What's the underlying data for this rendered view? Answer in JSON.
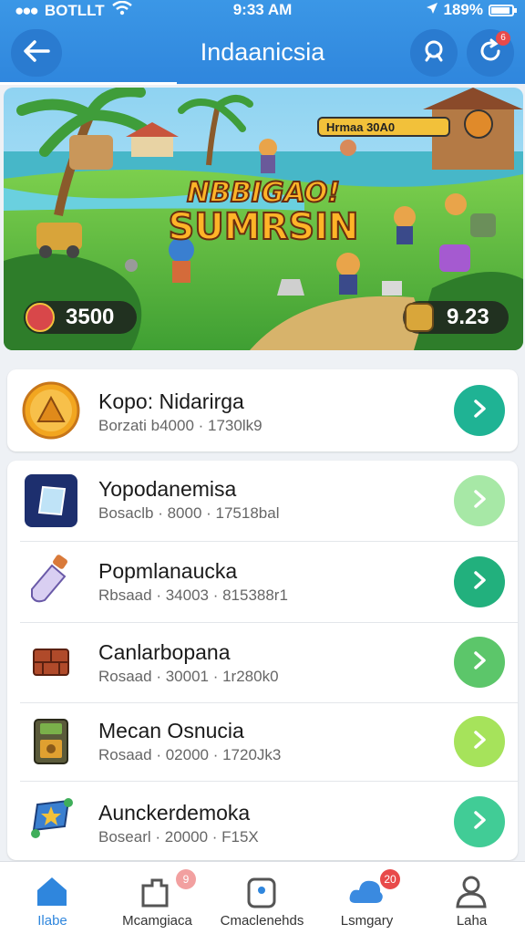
{
  "status_bar": {
    "carrier": "BOTLLT",
    "time": "9:33 AM",
    "battery": "189%"
  },
  "header": {
    "title": "Indaanicsia",
    "notification_count": "6"
  },
  "banner": {
    "title_line1": "NBBIGAO!",
    "title_line2": "SUMRSIN",
    "hud_text": "Hrmaa 30A0",
    "left_counter": "3500",
    "right_counter": "9.23"
  },
  "featured": {
    "title": "Kopo: Nidarirga",
    "subtitle": "Borzati b4000 · 1730lk9",
    "icon": "pyramid-coin-icon",
    "button_color": "#1fb394"
  },
  "items": [
    {
      "title": "Yopodanemisa",
      "subtitle": "Bosaclb · 8000 · 17518bal",
      "icon": "crystal-tile-icon",
      "button_color": "#a7e8a6"
    },
    {
      "title": "Popmlanaucka",
      "subtitle": "Rbsaad · 34003 · 815388r1",
      "icon": "potion-bottle-icon",
      "button_color": "#22b07d"
    },
    {
      "title": "Canlarbopana",
      "subtitle": "Rosaad · 30001 · 1r280k0",
      "icon": "brick-crate-icon",
      "button_color": "#5cc66a"
    },
    {
      "title": "Mecan Osnucia",
      "subtitle": "Rosaad · 02000 · 1720Jk3",
      "icon": "cog-cabinet-icon",
      "button_color": "#a6e35b"
    },
    {
      "title": "Aunckerdemoka",
      "subtitle": "Bosearl · 20000 · F15X",
      "icon": "star-gem-icon",
      "button_color": "#41cc96"
    }
  ],
  "bottom_nav": [
    {
      "label": "Ilabe",
      "icon": "home-icon",
      "badge": ""
    },
    {
      "label": "Mcamgiaca",
      "icon": "puzzle-icon",
      "badge": "9"
    },
    {
      "label": "Cmaclenehds",
      "icon": "backpack-icon",
      "badge": ""
    },
    {
      "label": "Lsmgary",
      "icon": "cloud-icon",
      "badge": "20"
    },
    {
      "label": "Laha",
      "icon": "profile-icon",
      "badge": ""
    }
  ],
  "colors": {
    "header": "#2f86dd",
    "accent_active": "#2a7bd0",
    "badge": "#e84a4a"
  }
}
